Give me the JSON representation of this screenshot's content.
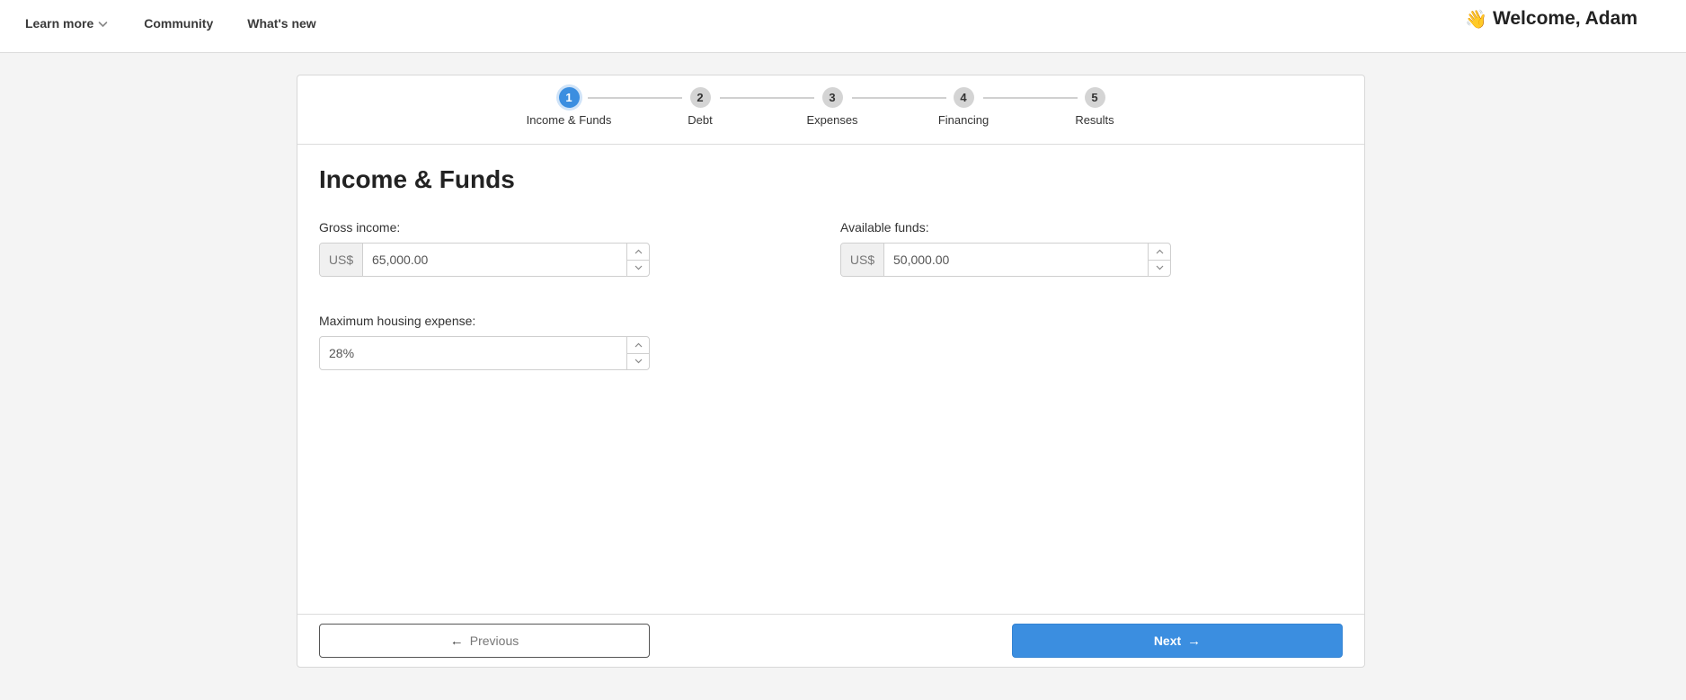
{
  "topbar": {
    "nav": [
      {
        "label": "Learn more",
        "has_dropdown": true,
        "icon": "chevron-down-icon"
      },
      {
        "label": "Community"
      },
      {
        "label": "What's new"
      }
    ],
    "welcome": {
      "emoji": "👋",
      "icon": "waving-hand-icon",
      "text": "Welcome, Adam"
    }
  },
  "stepper": {
    "active_step": 1,
    "steps": [
      {
        "number": "1",
        "label": "Income & Funds"
      },
      {
        "number": "2",
        "label": "Debt"
      },
      {
        "number": "3",
        "label": "Expenses"
      },
      {
        "number": "4",
        "label": "Financing"
      },
      {
        "number": "5",
        "label": "Results"
      }
    ],
    "colors": {
      "active": "#3b8ee0",
      "inactive": "#d4d4d4"
    }
  },
  "form": {
    "title": "Income & Funds",
    "fields": {
      "gross_income": {
        "label": "Gross income:",
        "prefix": "US$",
        "value": "65,000.00"
      },
      "available_funds": {
        "label": "Available funds:",
        "prefix": "US$",
        "value": "50,000.00"
      },
      "max_housing_expense": {
        "label": "Maximum housing expense:",
        "value": "28%"
      }
    }
  },
  "footer": {
    "previous_label": "Previous",
    "previous_icon": "arrow-left-icon",
    "next_label": "Next",
    "next_icon": "arrow-right-icon",
    "next_color": "#3b8ee0"
  }
}
